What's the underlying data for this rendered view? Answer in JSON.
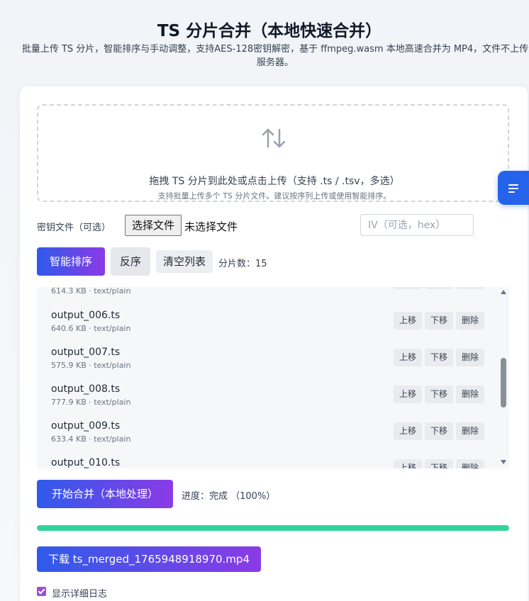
{
  "header": {
    "title": "TS 分片合并（本地快速合并）",
    "subtitle": "批量上传 TS 分片，智能排序与手动调整，支持AES-128密钥解密，基于 ffmpeg.wasm 本地高速合并为 MP4，文件不上传服务器。"
  },
  "dropzone": {
    "main_text": "拖拽 TS 分片到此处或点击上传（支持 .ts / .tsv，多选）",
    "hint_text": "支持批量上传多个 TS 分片文件。建议按序列上传或使用智能排序。"
  },
  "key": {
    "label": "密钥文件（可选）",
    "file_button": "选择文件",
    "file_status": "未选择文件",
    "iv_placeholder": "IV（可选，hex）"
  },
  "toolbar": {
    "smart_sort": "智能排序",
    "reverse": "反序",
    "clear": "清空列表",
    "segment_count": "分片数：15"
  },
  "segments": [
    {
      "name": "",
      "meta": "614.3 KB · text/plain"
    },
    {
      "name": "output_006.ts",
      "meta": "640.6 KB · text/plain"
    },
    {
      "name": "output_007.ts",
      "meta": "575.9 KB · text/plain"
    },
    {
      "name": "output_008.ts",
      "meta": "777.9 KB · text/plain"
    },
    {
      "name": "output_009.ts",
      "meta": "633.4 KB · text/plain"
    },
    {
      "name": "output_010.ts",
      "meta": ""
    }
  ],
  "segment_actions": {
    "move_up": "上移",
    "move_down": "下移",
    "delete": "删除"
  },
  "merge": {
    "button": "开始合并（本地处理）",
    "progress_text": "进度：完成 （100%）",
    "progress": 1.0
  },
  "download": {
    "button": "下载 ts_merged_1765948918970.mp4"
  },
  "log": {
    "label": "显示详细日志",
    "checked": true
  },
  "colors": {
    "accent_start": "#2f5bea",
    "accent_end": "#8b3ae6",
    "progress": "#34d399",
    "float_button": "#2563eb"
  }
}
